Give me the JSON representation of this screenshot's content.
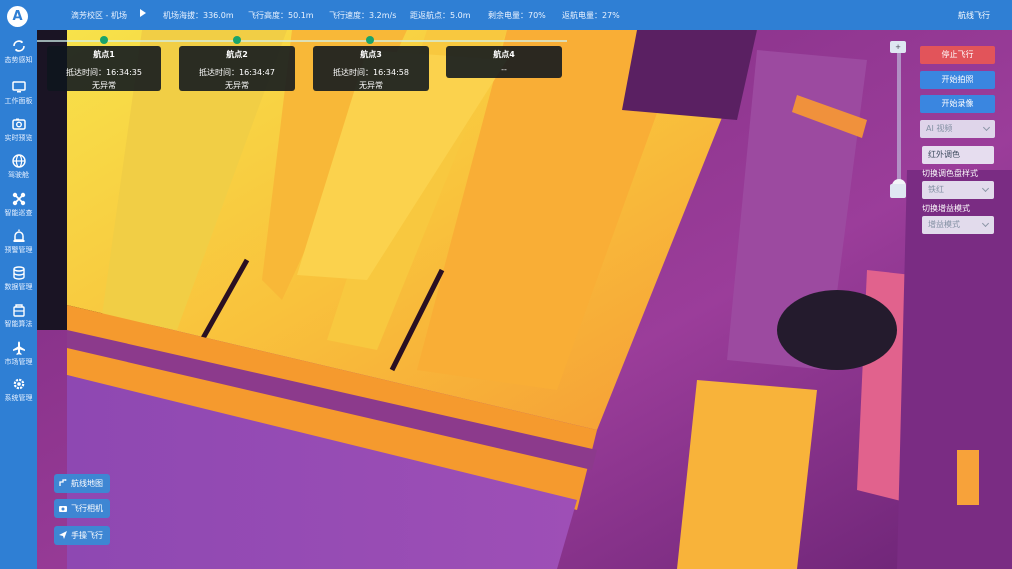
{
  "app": {
    "logo_letter": "A"
  },
  "sidebar": {
    "items": [
      {
        "label": "态势感知",
        "icon": "sync-icon"
      },
      {
        "label": "工作面板",
        "icon": "monitor-icon"
      },
      {
        "label": "实时预览",
        "icon": "camera-icon"
      },
      {
        "label": "驾驶舱",
        "icon": "globe-icon"
      },
      {
        "label": "智能巡查",
        "icon": "drone-icon"
      },
      {
        "label": "预警管理",
        "icon": "alarm-icon"
      },
      {
        "label": "数据管理",
        "icon": "database-icon"
      },
      {
        "label": "智能算法",
        "icon": "chip-icon"
      },
      {
        "label": "市场管理",
        "icon": "airplane-icon"
      },
      {
        "label": "系统管理",
        "icon": "gear-icon"
      }
    ]
  },
  "topbar": {
    "location": "滴芳校区 - 机场",
    "stats": [
      "机场海拔：336.0m",
      "飞行高度：50.1m",
      "飞行速度：3.2m/s",
      "距返航点：5.0m",
      "剩余电量：70%",
      "返航电量：27%"
    ],
    "mode": "航线飞行"
  },
  "waypoints": [
    {
      "title": "航点1",
      "arrival": "抵达时间：16:34:35",
      "status": "无异常"
    },
    {
      "title": "航点2",
      "arrival": "抵达时间：16:34:47",
      "status": "无异常"
    },
    {
      "title": "航点3",
      "arrival": "抵达时间：16:34:58",
      "status": "无异常"
    },
    {
      "title": "航点4",
      "arrival": "--",
      "status": ""
    }
  ],
  "controls": {
    "zoom_plus": "+",
    "stop_flight": "停止飞行",
    "start_photo": "开始拍照",
    "start_record": "开始录像",
    "video_select": "AI 视频",
    "infrared_option": "红外调色",
    "palette_label": "切换调色盘样式",
    "palette_value": "铁红",
    "gain_label": "切换增益模式",
    "gain_value": "增益模式"
  },
  "bottom_buttons": {
    "route_map": "航线地图",
    "flight_camera": "飞行相机",
    "manual_flight": "手操飞行"
  },
  "colors": {
    "primary": "#2f7fd4",
    "button_blue": "#3a86e0",
    "stop_red": "#e2545a",
    "waypoint_done": "#1aa36a"
  }
}
